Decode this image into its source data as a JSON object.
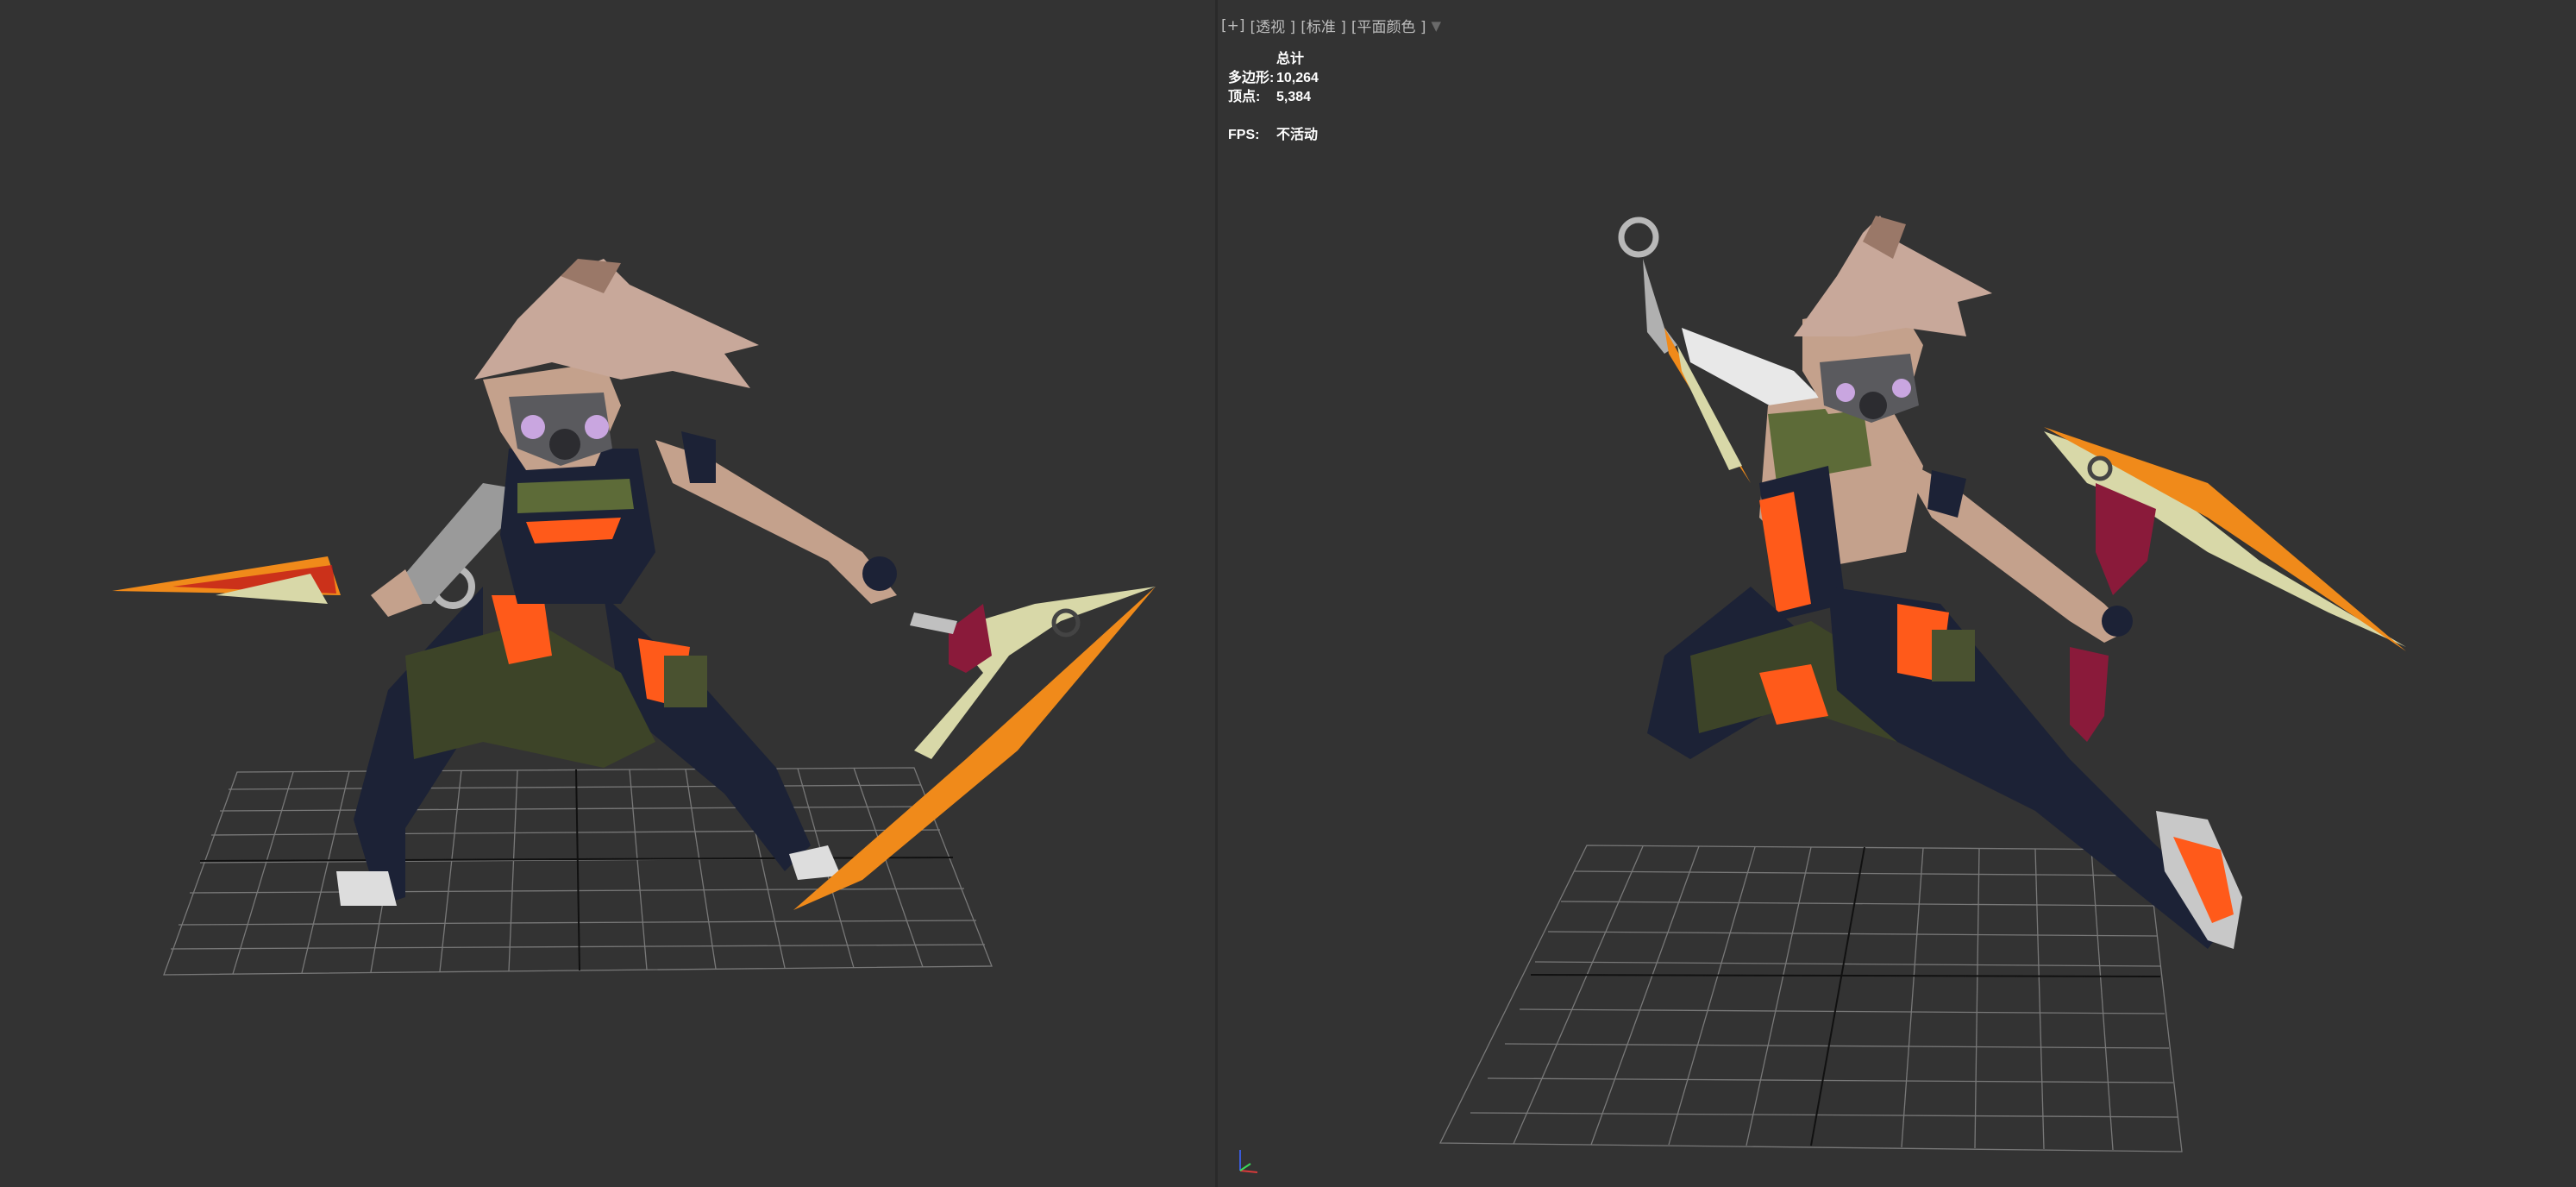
{
  "viewport_label": {
    "plus": "[+]",
    "view": "[透视 ]",
    "mode": "[标准 ]",
    "shading": "[平面颜色 ]",
    "filter_icon": "filter-icon"
  },
  "stats": {
    "header": "总计",
    "polygons_label": "多边形:",
    "polygons_value": "10,264",
    "vertices_label": "顶点:",
    "vertices_value": "5,384",
    "fps_label": "FPS:",
    "fps_value": "不活动"
  },
  "colors": {
    "background": "#333333",
    "grid": "#8a8a8a",
    "blade_orange": "#f08a1a",
    "blade_red": "#c21a1a",
    "outfit_dark": "#1c2236",
    "accent_orange": "#ff5a1a",
    "hair": "#c8a89a"
  },
  "icons": [
    "axis-gizmo-icon",
    "filter-icon"
  ]
}
